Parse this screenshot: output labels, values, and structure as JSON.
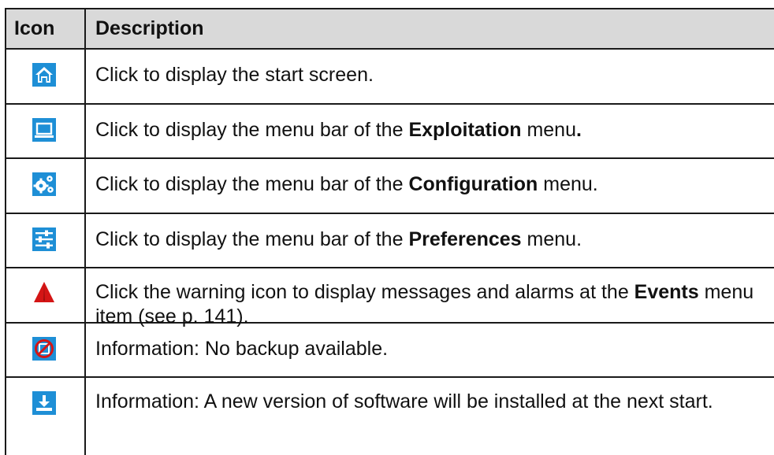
{
  "headers": {
    "icon": "Icon",
    "description": "Description"
  },
  "colors": {
    "icon_blue": "#1e8fd6",
    "warning_red": "#d41515",
    "header_bg": "#d9d9d9"
  },
  "rows": [
    {
      "icon": "home-icon",
      "parts": [
        "Click to display the start screen."
      ]
    },
    {
      "icon": "laptop-icon",
      "parts": [
        "Click to display the menu bar of the ",
        "Exploitation",
        " menu",
        "."
      ]
    },
    {
      "icon": "gears-icon",
      "parts": [
        "Click to display the menu bar of the ",
        "Configuration",
        " menu."
      ]
    },
    {
      "icon": "sliders-icon",
      "parts": [
        "Click to display the menu bar of the ",
        "Preferences",
        " menu."
      ]
    },
    {
      "icon": "warning-icon",
      "parts": [
        "Click the warning icon to display messages and alarms at the ",
        "Events",
        " menu item (see p. 141)."
      ]
    },
    {
      "icon": "no-backup-icon",
      "parts": [
        "Information: No backup available."
      ]
    },
    {
      "icon": "download-icon",
      "parts": [
        "Information: A new version of software will be installed at the next start."
      ]
    }
  ]
}
